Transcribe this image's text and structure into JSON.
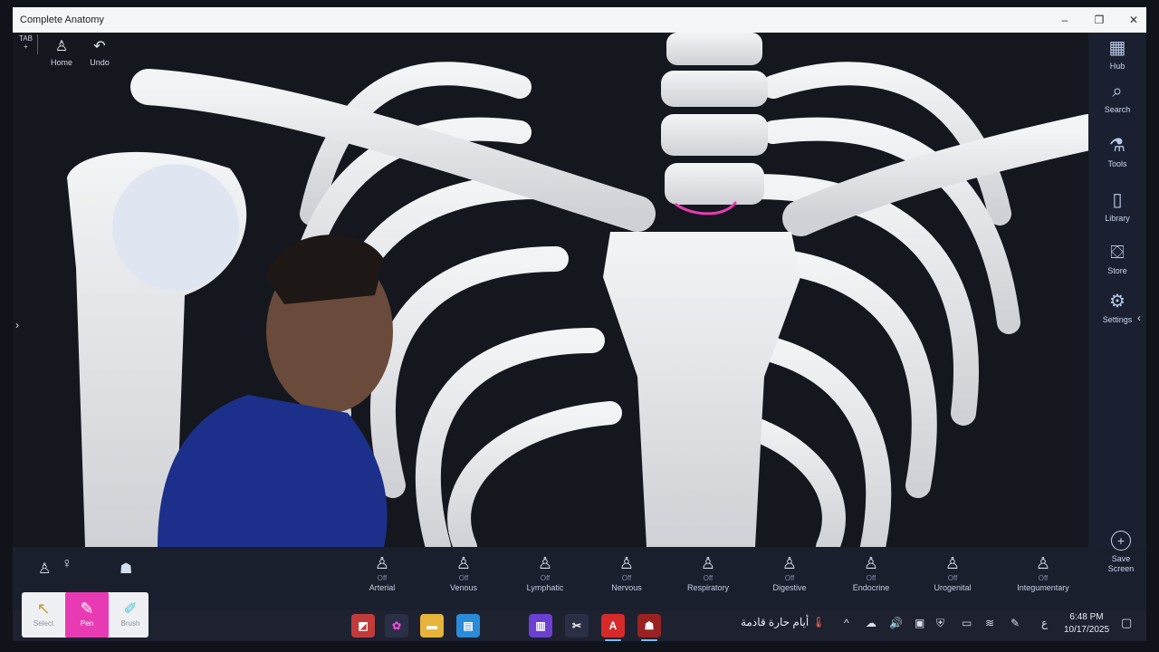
{
  "window": {
    "title": "Complete Anatomy",
    "controls": [
      "–",
      "❐",
      "✕"
    ]
  },
  "top_tools": {
    "tab_label": "TAB",
    "tab_plus": "+",
    "home": "Home",
    "undo": "Undo"
  },
  "sidebar": {
    "items": [
      {
        "label": "Hub",
        "icon": "hub-icon"
      },
      {
        "label": "Search",
        "icon": "search-icon"
      },
      {
        "label": "Tools",
        "icon": "tools-icon"
      },
      {
        "label": "Library",
        "icon": "library-icon"
      },
      {
        "label": "Store",
        "icon": "store-icon"
      },
      {
        "label": "Settings",
        "icon": "gear-icon"
      }
    ]
  },
  "systems": [
    {
      "label": "Arterial",
      "state": "Off"
    },
    {
      "label": "Venous",
      "state": "Off"
    },
    {
      "label": "Lymphatic",
      "state": "Off"
    },
    {
      "label": "Nervous",
      "state": "Off"
    },
    {
      "label": "Respiratory",
      "state": "Off"
    },
    {
      "label": "Digestive",
      "state": "Off"
    },
    {
      "label": "Endocrine",
      "state": "Off"
    },
    {
      "label": "Urogenital",
      "state": "Off"
    },
    {
      "label": "Integumentary",
      "state": "Off"
    }
  ],
  "save_screen": {
    "line1": "Save",
    "line2": "Screen"
  },
  "palette": {
    "select": "Select",
    "pen": "Pen",
    "brush": "Brush"
  },
  "taskbar": {
    "weather_text": "أيام حارة قادمة",
    "input_lang": "ع",
    "time": "6:48 PM",
    "date": "10/17/2025"
  },
  "colors": {
    "pen_accent": "#e83bb3",
    "annotation": "#e83bb3",
    "bone": "#e9eaec"
  }
}
